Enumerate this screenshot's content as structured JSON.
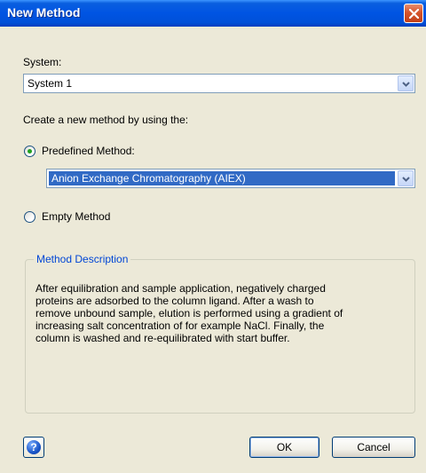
{
  "window": {
    "title": "New Method"
  },
  "system": {
    "label": "System:",
    "value": "System 1"
  },
  "create_label": "Create a new method by using the:",
  "predefined": {
    "label": "Predefined Method:",
    "selected": true,
    "value": "Anion Exchange Chromatography (AIEX)"
  },
  "empty": {
    "label": "Empty Method",
    "selected": false
  },
  "description": {
    "title": "Method Description",
    "lines": [
      "After equilibration and sample application, negatively charged",
      "proteins are adsorbed to the column ligand. After a wash to",
      "remove unbound sample, elution is performed using a gradient of",
      "increasing salt concentration of for example NaCl. Finally, the",
      "column is washed and re-equilibrated with start buffer."
    ]
  },
  "buttons": {
    "help": "?",
    "ok": "OK",
    "cancel": "Cancel"
  },
  "colors": {
    "titlebar": "#0054e3",
    "selection": "#316ac5",
    "group_title": "#0046d5",
    "face": "#ece9d8"
  }
}
